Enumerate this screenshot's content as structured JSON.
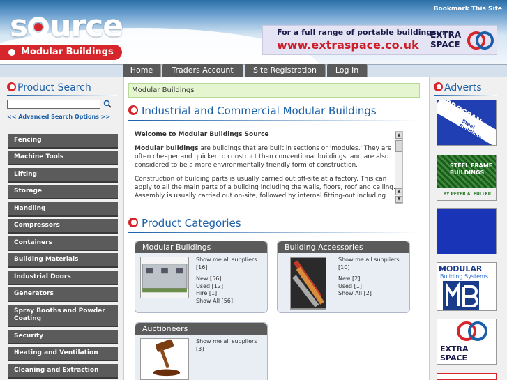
{
  "header": {
    "logo_text": "source",
    "subtitle": "Modular Buildings",
    "bookmark": "Bookmark This Site",
    "banner": {
      "line1": "For a full range of portable buildings...",
      "line2": "www.extraspace.co.uk",
      "brand": "EXTRA SPACE"
    }
  },
  "nav": {
    "tabs": [
      "Home",
      "Traders Account",
      "Site Registration",
      "Log In"
    ]
  },
  "sidebar": {
    "product_search_title": "Product Search",
    "search_placeholder": "",
    "advanced_search": "<< Advanced Search Options >>",
    "categories": [
      "Fencing",
      "Machine Tools",
      "Lifting",
      "Storage",
      "Handling",
      "Compressors",
      "Containers",
      "Building Materials",
      "Industrial Doors",
      "Generators",
      "Spray Booths and Powder Coating",
      "Security",
      "Heating and Ventilation",
      "Cleaning and Extraction"
    ]
  },
  "main": {
    "breadcrumb": "Modular Buildings",
    "page_title": "Industrial and Commercial Modular Buildings",
    "intro": {
      "welcome": "Welcome to Modular Buildings Source",
      "p1_bold": "Modular buildings",
      "p1_rest": " are buildings that are built in sections or 'modules.' They are often cheaper and quicker to construct than conventional buildings, and are also considered to be a more environmentally friendly form of construction.",
      "p2": "Construction of building parts is usually carried out off-site at a factory. This can apply to all the main parts of a building including the walls, floors, roof and ceiling. Assembly is usually carried out on-site, followed by internal fitting-out including"
    },
    "categories_title": "Product Categories",
    "cards": [
      {
        "title": "Modular Buildings",
        "show_all": "Show me all suppliers",
        "count": "[16]",
        "lines": [
          "New [56]",
          "Used [12]",
          "Hire [1]",
          "Show All [56]"
        ]
      },
      {
        "title": "Building Accessories",
        "show_all": "Show me all suppliers",
        "count": "[10]",
        "lines": [
          "New [2]",
          "Used [1]",
          "Show All [2]"
        ]
      },
      {
        "title": "Auctioneers",
        "show_all": "Show me all suppliers",
        "count": "[3]",
        "lines": []
      }
    ]
  },
  "adverts": {
    "title": "Adverts",
    "items": [
      {
        "text": "PROSPAN",
        "sub": "Steel Buildings"
      },
      {
        "text": "STEEL FRAME BUILDINGS",
        "sub": "BY PETER A. FULLER"
      },
      {
        "text": "",
        "sub": ""
      },
      {
        "text": "MODULAR",
        "sub": "Building Systems"
      },
      {
        "text": "EXTRA",
        "sub": "SPACE"
      }
    ]
  },
  "colors": {
    "brand_red": "#d6262b",
    "brand_blue": "#1a5fa8",
    "tab_grey": "#5b5b5b"
  }
}
